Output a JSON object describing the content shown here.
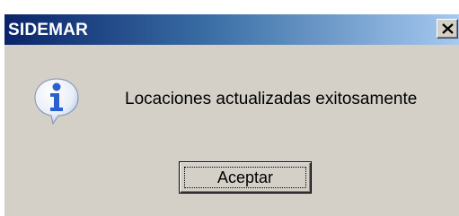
{
  "window": {
    "title": "SIDEMAR",
    "close_glyph": "✕"
  },
  "icon": {
    "name": "info-icon",
    "glyph": "i"
  },
  "message": "Locaciones actualizadas exitosamente",
  "buttons": {
    "ok_label": "Aceptar"
  },
  "colors": {
    "titlebar_start": "#0a246a",
    "titlebar_end": "#a6caf0",
    "dialog_face": "#d4d0c8",
    "icon_blue": "#2b5fd0"
  }
}
